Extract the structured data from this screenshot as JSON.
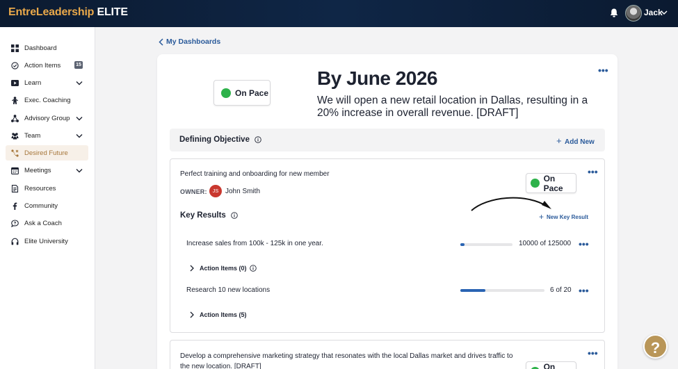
{
  "header": {
    "brand_part1": "EntreLeadership",
    "brand_part2": "ELITE",
    "user_name": "Jack"
  },
  "sidebar": {
    "items": [
      {
        "label": "Dashboard",
        "icon": "grid-icon"
      },
      {
        "label": "Action Items",
        "icon": "check-circle-icon",
        "badge": "15"
      },
      {
        "label": "Learn",
        "icon": "play-icon",
        "has_chevron": true
      },
      {
        "label": "Exec. Coaching",
        "icon": "coaching-icon"
      },
      {
        "label": "Advisory Group",
        "icon": "network-icon",
        "has_chevron": true
      },
      {
        "label": "Team",
        "icon": "team-icon",
        "has_chevron": true
      },
      {
        "label": "Desired Future",
        "icon": "desired-future-icon",
        "active": true
      },
      {
        "label": "Meetings",
        "icon": "calendar-icon",
        "has_chevron": true
      },
      {
        "label": "Resources",
        "icon": "document-icon"
      },
      {
        "label": "Community",
        "icon": "facebook-icon"
      },
      {
        "label": "Ask a Coach",
        "icon": "chat-icon"
      },
      {
        "label": "Elite University",
        "icon": "headphones-icon"
      }
    ]
  },
  "main": {
    "back_label": "My Dashboards",
    "goal": {
      "status": "On Pace",
      "title": "By June 2026",
      "description": "We will open a new retail location in Dallas, resulting in a 20% increase in overall revenue. [DRAFT]"
    },
    "defining_objective": {
      "title": "Defining Objective",
      "add_label": "Add New"
    },
    "objectives": [
      {
        "name": "Perfect training and onboarding for new member",
        "owner_label": "OWNER:",
        "owner_initials": "JS",
        "owner_name": "John Smith",
        "status": "On Pace",
        "key_results_title": "Key Results",
        "new_key_result_label": "New Key Result",
        "key_results": [
          {
            "name": "Increase sales from 100k - 125k in one year.",
            "count": "10000 of 125000",
            "progress": 0.08,
            "action_items": "Action Items (0)"
          },
          {
            "name": "Research 10 new locations",
            "count": "6 of 20",
            "progress": 0.3,
            "action_items": "Action Items (5)"
          }
        ]
      },
      {
        "name": "Develop a comprehensive marketing strategy that resonates with the local Dallas market and drives traffic to the new location. [DRAFT]",
        "status": "On Pace"
      }
    ]
  },
  "help": {
    "label": "?"
  },
  "colors": {
    "accent_blue": "#2a5a9a",
    "status_green": "#2eb24b",
    "brand_gold": "#e9a84a",
    "active_nav": "#a6763a"
  }
}
